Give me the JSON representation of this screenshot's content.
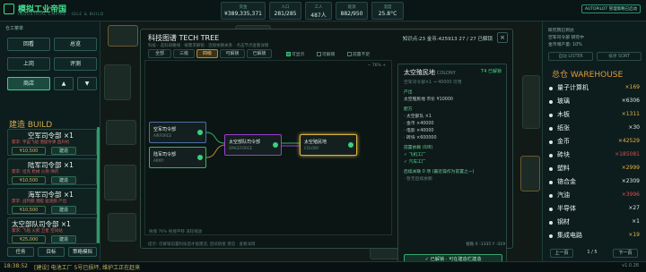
{
  "app": {
    "title": "模拟工业帝国",
    "subtitle": "INDUSTRIAL EMPIRE · IDLE & BUILD"
  },
  "stats": [
    {
      "label": "资金",
      "value": "¥389,335,371"
    },
    {
      "label": "人口",
      "value": "281/285"
    },
    {
      "label": "工人",
      "value": "487人"
    },
    {
      "label": "能源",
      "value": "882/950"
    },
    {
      "label": "温度",
      "value": "25.8°C"
    }
  ],
  "autopilot_label": "AUTOPILOT 管理策略已启动",
  "left": {
    "title": "仓工菜单",
    "buttons": [
      "回看",
      "总览",
      "上岗",
      "评测",
      "商店"
    ],
    "arrow_up": "▲",
    "arrow_down": "▼",
    "build_title": "建造 BUILD",
    "cards": [
      {
        "name": "空军司令部 ×1",
        "req": "需求: 宇宙飞船 潜艇导弹 直升机",
        "cost": "¥10,500",
        "go": "建造"
      },
      {
        "name": "陆军司令部 ×1",
        "req": "需求: 坦克 枪械 火炮 弹药",
        "cost": "¥10,500",
        "go": "建造"
      },
      {
        "name": "海军司令部 ×1",
        "req": "需求: 战列舰 潜艇 驱逐舰 产出",
        "cost": "¥10,500",
        "go": "建造"
      },
      {
        "name": "太空部队司令部 ×1",
        "req": "需求: 飞船 火箭 卫星 空间站",
        "cost": "¥25,000",
        "go": "建造"
      }
    ],
    "bottom_buttons": [
      "任务",
      "目标",
      "策略模拟"
    ]
  },
  "modal": {
    "title": "科技图谱  TECH TREE",
    "desc": "科技 - 选科研路线 · 按需求解锁 · 连接依赖关系 · 点击节点查看详情",
    "right_info": "知识点:23  金币:425913  27 / 27 已解锁",
    "close": "×",
    "filters": [
      "全部",
      "三级",
      "四级",
      "可解锁",
      "已解锁"
    ],
    "checks": [
      {
        "label": "可显示",
        "on": true
      },
      {
        "label": "可解锁",
        "on": false
      },
      {
        "label": "前置不足",
        "on": false
      }
    ],
    "zoom": "− 76% +",
    "nodes": [
      {
        "name": "空军司令部",
        "sub": "AIRFORCE"
      },
      {
        "name": "陆军司令部",
        "sub": "ARMY"
      },
      {
        "name": "太空部队司令部",
        "sub": "SPACEFORCE"
      },
      {
        "name": "太空殖民地",
        "sub": "COLONY"
      }
    ],
    "canvas_foot": "拖拽 76%   拖拽平移   滚轮缩放",
    "detail": {
      "title": "太空殖民地",
      "title_en": "COLONY",
      "tier": "T4",
      "status": "已解锁",
      "lines": [
        {
          "t": "空军司令部×1 → 40000 可用",
          "c": "muted"
        },
        {
          "t": "产出",
          "c": "sec"
        },
        {
          "t": "太空殖民地  市价 ¥10000",
          "c": ""
        },
        {
          "t": "配方",
          "c": "sec"
        },
        {
          "t": "· 太空部队 ×1",
          "c": ""
        },
        {
          "t": "· 金币 ×40000",
          "c": ""
        },
        {
          "t": "· 电影 ×40000",
          "c": ""
        },
        {
          "t": "· 砖块 ×600000",
          "c": ""
        },
        {
          "t": "前置依赖 (0/8)",
          "c": "sec"
        },
        {
          "t": "✓ 飞机工厂",
          "c": "ok"
        },
        {
          "t": "✓ 汽车工厂",
          "c": "ok"
        },
        {
          "t": "后续关联 0 项 (最近操作为前置之一)",
          "c": "sec"
        },
        {
          "t": "· 暂无后续依赖",
          "c": "muted"
        }
      ],
      "button": "✓ 已解锁 · 可在建造栏建造"
    },
    "foot": "提示: 仅解锁前置科技后才能建造, 后续链接 建造 · 查看详情",
    "foot_right": "视角 X -1335  Y -319"
  },
  "right": {
    "line1": "研究院已到达",
    "line2": "空军司令部  研究中",
    "line3": "金币增产量: 10%",
    "btn1": "自动 LISTER",
    "btn2": "排序 SORT",
    "wh_title": "总仓 WAREHOUSE",
    "items": [
      {
        "name": "量子计算机",
        "qty": "×169",
        "color": "#e4b347"
      },
      {
        "name": "玻璃",
        "qty": "×6306",
        "color": "#e0e8e6"
      },
      {
        "name": "木板",
        "qty": "×1311",
        "color": "#e4b347"
      },
      {
        "name": "纸张",
        "qty": "×30",
        "color": "#e0e8e6"
      },
      {
        "name": "金币",
        "qty": "×42529",
        "color": "#e4b347"
      },
      {
        "name": "砖块",
        "qty": "×185081",
        "color": "#e04b4b"
      },
      {
        "name": "塑料",
        "qty": "×2999",
        "color": "#e4b347"
      },
      {
        "name": "铬合金",
        "qty": "×2309",
        "color": "#e0e8e6"
      },
      {
        "name": "汽油",
        "qty": "×3996",
        "color": "#e04b4b"
      },
      {
        "name": "半导体",
        "qty": "×27",
        "color": "#e0e8e6"
      },
      {
        "name": "钢材",
        "qty": "×1",
        "color": "#e0e8e6"
      },
      {
        "name": "集成电路",
        "qty": "×19",
        "color": "#e4b347"
      }
    ],
    "prev": "上一页",
    "page": "1 / 5",
    "next": "下一页"
  },
  "status": {
    "time": "18:38:52",
    "msg": "[建设] 电池工厂 5号已损坏, 维护工正在赶来",
    "version": "v1.0.28"
  }
}
